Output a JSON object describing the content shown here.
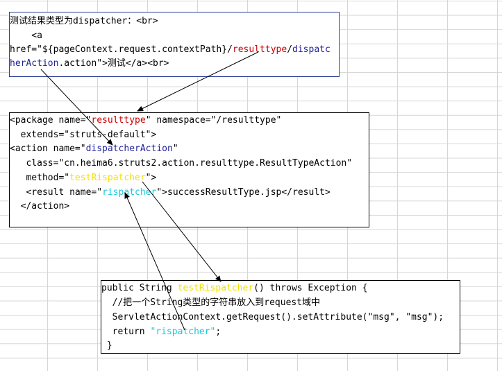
{
  "box1": {
    "line1": "测试结果类型为dispatcher：<br>",
    "line2": "    <a",
    "line3_pre": "href=\"${pageContext.request.contextPath}/",
    "line3_rt": "resulttype",
    "line3_slash": "/",
    "line3_disp": "dispatc",
    "line4_disp": "herAction",
    "line4_rest": ".action\">测试</a><br>"
  },
  "box2": {
    "l1_pre": "<package name=\"",
    "l1_name": "resulttype",
    "l1_post": "\" namespace=\"/resulttype\"",
    "l2": "  extends=\"struts-default\">",
    "l3_pre": "<action name=\"",
    "l3_name": "dispatcherAction",
    "l3_post": "\"",
    "l4": "   class=\"cn.heima6.struts2.action.resulttype.ResultTypeAction\"",
    "l5_pre": "   method=\"",
    "l5_method": "testRispatcher",
    "l5_post": "\">",
    "l6_pre": "   <result name=\"",
    "l6_name": "rispatcher",
    "l6_post": "\">successResultType.jsp</result>",
    "l7": "  </action>"
  },
  "box3": {
    "l1_pre": "public String ",
    "l1_method": "testRispatcher",
    "l1_post": "() throws Exception {",
    "l2": "  //把一个String类型的字符串放入到request域中",
    "l3": "  ServletActionContext.getRequest().setAttribute(\"msg\", \"msg\");",
    "l4_pre": "  return ",
    "l4_val": "\"rispatcher\"",
    "l4_post": ";",
    "l5": " }"
  }
}
